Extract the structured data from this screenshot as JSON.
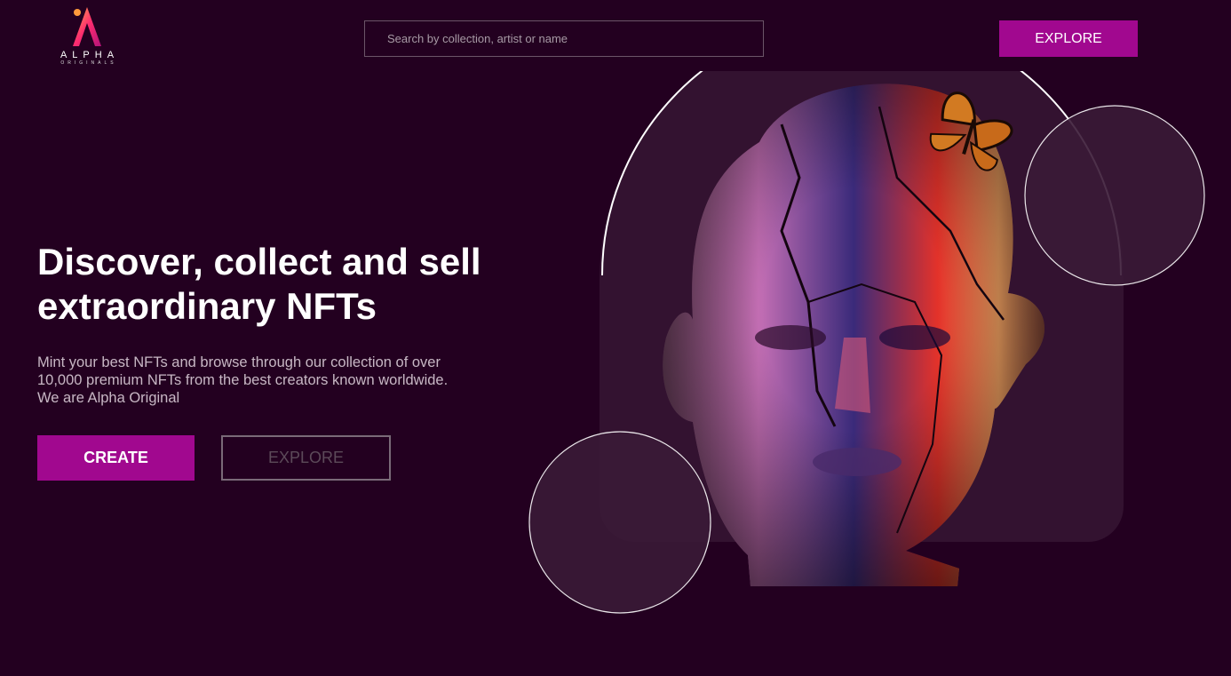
{
  "brand": {
    "name": "ALPHA",
    "sub": "ORIGINALS"
  },
  "header": {
    "search_placeholder": "Search by collection, artist or name",
    "explore_label": "EXPLORE"
  },
  "hero": {
    "headline_line1": "Discover, collect and sell",
    "headline_line2": "extraordinary NFTs",
    "desc_line1": "Mint your best NFTs and browse through our collection of over",
    "desc_line2": "10,000 premium NFTs from the best creators known worldwide.",
    "desc_line3": "We are Alpha Original",
    "create_label": "CREATE",
    "explore_label": "EXPLORE"
  },
  "colors": {
    "background": "#230020",
    "accent": "#a1088f"
  },
  "icons": {
    "logo": "alpha-originals-logo",
    "hero_art": "cracked-head-with-butterfly"
  }
}
